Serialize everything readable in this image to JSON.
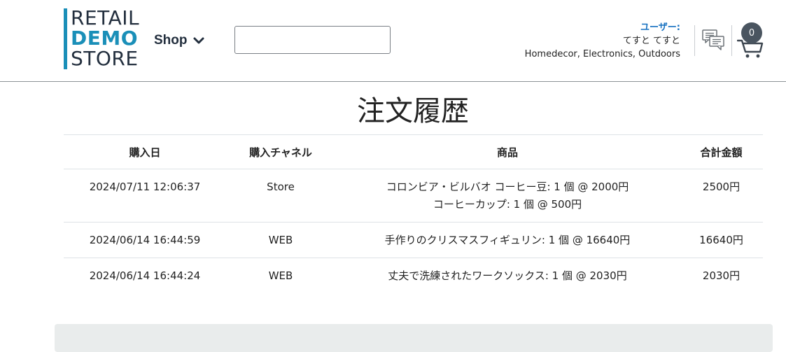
{
  "brand": {
    "line1": "RETAIL",
    "line2": "DEMO",
    "line3": "STORE",
    "accent_color": "#1a8fb8"
  },
  "nav": {
    "shop_label": "Shop",
    "shop_icon": "chevron-down-icon"
  },
  "search": {
    "placeholder": "",
    "value": "",
    "icon": "search-icon"
  },
  "user": {
    "label": "ユーザー:",
    "name": "てすと てすと",
    "interests": "Homedecor, Electronics, Outdoors"
  },
  "header_icons": {
    "chat": "chat-bubbles-icon",
    "cart": "cart-icon",
    "cart_count": "0"
  },
  "page": {
    "title": "注文履歴"
  },
  "orders": {
    "headers": [
      "購入日",
      "購入チャネル",
      "商品",
      "合計金額"
    ],
    "rows": [
      {
        "date": "2024/07/11 12:06:37",
        "channel": "Store",
        "items": [
          "コロンビア・ビルバオ コーヒー豆: 1 個 @ 2000円",
          "コーヒーカップ: 1 個 @ 500円"
        ],
        "total": "2500円"
      },
      {
        "date": "2024/06/14 16:44:59",
        "channel": "WEB",
        "items": [
          "手作りのクリスマスフィギュリン: 1 個 @ 16640円"
        ],
        "total": "16640円"
      },
      {
        "date": "2024/06/14 16:44:24",
        "channel": "WEB",
        "items": [
          "丈夫で洗練されたワークソックス: 1 個 @ 2030円"
        ],
        "total": "2030円"
      }
    ]
  },
  "colors": {
    "link": "#1570c0",
    "badge": "#4a5560",
    "footer_band": "#e9ecec"
  }
}
